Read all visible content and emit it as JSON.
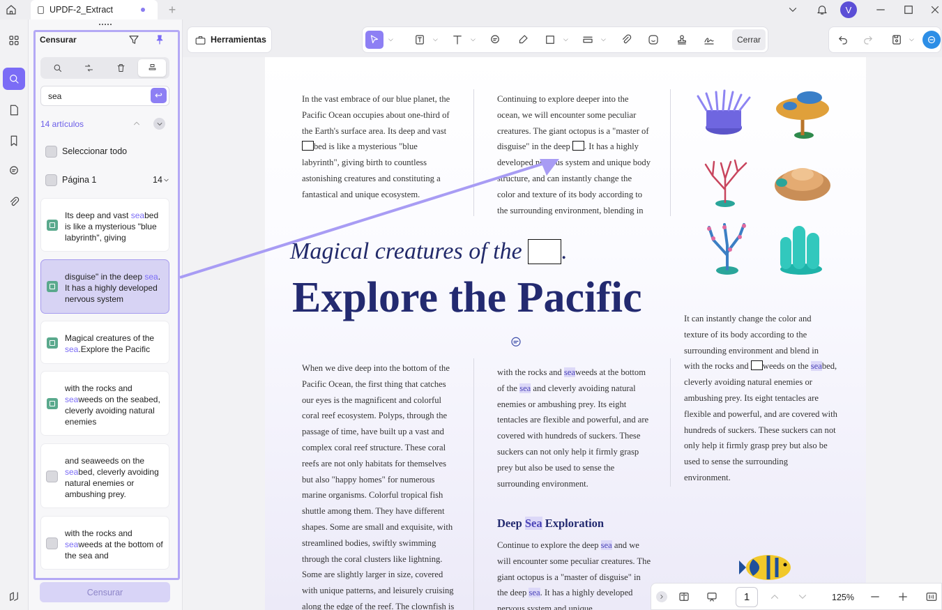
{
  "tab": {
    "title": "UPDF-2_Extract"
  },
  "user": {
    "avatar": "V"
  },
  "panel": {
    "title": "Censurar",
    "search_value": "sea",
    "count": "14 artículos",
    "select_all": "Seleccionar todo",
    "page_label": "Página 1",
    "page_count": "14",
    "button": "Censurar",
    "results": [
      {
        "pre": "Its deep and vast ",
        "hl": "sea",
        "post": "bed is like a mysterious \"blue labyrinth\", giving"
      },
      {
        "pre": "disguise\" in the deep ",
        "hl": "sea",
        "post": ". It has a highly developed nervous system"
      },
      {
        "pre": "Magical creatures of the ",
        "hl": "sea",
        "post": ".Explore the Pacific"
      },
      {
        "pre": "with the rocks and ",
        "hl": "sea",
        "post": "weeds on the seabed, cleverly avoiding natural enemies"
      },
      {
        "pre": "and seaweeds on the ",
        "hl": "sea",
        "post": "bed, cleverly avoiding natural enemies or ambushing prey."
      },
      {
        "pre": "with the rocks and ",
        "hl": "sea",
        "post": "weeds at the bottom of the sea and"
      }
    ]
  },
  "toolbar": {
    "tools_label": "Herramientas",
    "close_label": "Cerrar"
  },
  "doc": {
    "col1_top": [
      "In the vast embrace of our blue planet, the",
      "Pacific Ocean occupies about one-third of",
      "the Earth's surface area. Its deep and vast"
    ],
    "col1_top_mark_after": "bed is like a mysterious \"blue",
    "col1_top_rest": [
      "labyrinth\", giving birth to countless",
      "astonishing creatures and constituting a",
      "fantastical and unique ecosystem."
    ],
    "col2_top_a": [
      "Continuing to explore deeper into the",
      "ocean, we will encounter some peculiar",
      "creatures. The giant octopus is a \"master of"
    ],
    "col2_top_mark_before": "disguise\" in the deep ",
    "col2_top_mark_after": ". It has a highly",
    "col2_top_rest": [
      "developed nervous system and unique body",
      "structure, and can instantly change the",
      "color and texture of its body according to",
      "the surrounding environment, blending in"
    ],
    "heading_italic": "Magical creatures of the",
    "heading_dot": ".",
    "heading_big": "Explore the Pacific",
    "col3_a": [
      "It can instantly change the color and",
      "texture of its body according to the",
      "surrounding environment and blend in"
    ],
    "col3_mark_before": "with the rocks and ",
    "col3_mark_after": "weeds on the ",
    "col3_hl": "sea",
    "col3_mark_tail": "bed,",
    "col3_rest": [
      "cleverly avoiding natural enemies or",
      "ambushing prey. Its eight tentacles are",
      "flexible and powerful, and are covered with",
      "hundreds of suckers. These suckers can not",
      "only help it firmly grasp prey but also be",
      "used to sense the surrounding",
      "environment."
    ],
    "col1_bottom": [
      "When we dive deep into the bottom of the",
      "Pacific Ocean, the first thing that catches",
      "our eyes is the magnificent and colorful",
      "coral reef ecosystem. Polyps, through the",
      "passage of time, have built up a vast and",
      "complex coral reef structure. These coral",
      "reefs are not only habitats for themselves",
      "but also \"happy homes\" for numerous",
      "marine organisms. Colorful tropical fish",
      "shuttle among them. They have different",
      "shapes. Some are small and exquisite, with",
      "streamlined bodies, swiftly swimming",
      "through the coral clusters like lightning.",
      "Some are slightly larger in size, covered",
      "with unique patterns, and leisurely cruising",
      "along the edge of the reef. The clownfish is"
    ],
    "col2_b1_pre": "with the rocks and ",
    "col2_b1_hl": "sea",
    "col2_b1_post": "weeds at the bottom",
    "col2_b2_pre": "of the ",
    "col2_b2_hl": "sea",
    "col2_b2_post": " and cleverly avoiding natural",
    "col2_bottom_rest": [
      "enemies or ambushing prey. Its eight",
      "tentacles are flexible and powerful, and are",
      "covered with hundreds of suckers. These",
      "suckers can not only help it firmly grasp",
      "prey but also be used to sense the",
      "surrounding environment."
    ],
    "subhead_pre": "Deep ",
    "subhead_hl": "Sea",
    "subhead_post": " Exploration",
    "col2_s1_pre": "Continue to explore the deep ",
    "col2_s1_hl": "sea",
    "col2_s1_post": " and we",
    "col2_s_mid": [
      "will encounter some peculiar creatures. The",
      "giant octopus is a \"master of disguise\" in"
    ],
    "col2_s4_pre": "the deep ",
    "col2_s4_hl": "sea",
    "col2_s4_post": ". It has a highly developed",
    "col2_s5": "nervous system and unique"
  },
  "nav": {
    "page": "1",
    "zoom": "125%"
  }
}
